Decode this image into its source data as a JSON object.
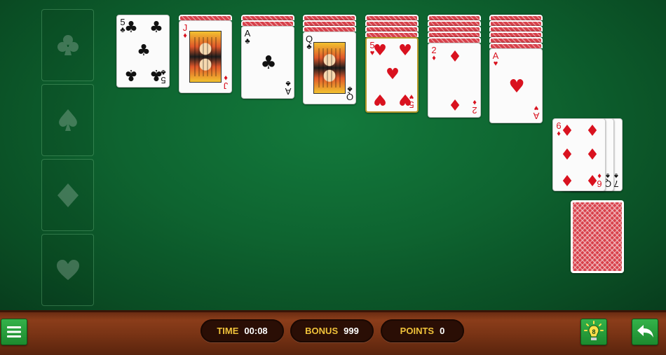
{
  "foundations": [
    {
      "suit": "clubs",
      "icon": "club-icon"
    },
    {
      "suit": "spades",
      "icon": "spade-icon"
    },
    {
      "suit": "diamonds",
      "icon": "diamond-icon"
    },
    {
      "suit": "hearts",
      "icon": "heart-icon"
    }
  ],
  "tableau": [
    {
      "hidden": 0,
      "top": {
        "rank": "5",
        "suit": "♣",
        "color": "black"
      }
    },
    {
      "hidden": 1,
      "top": {
        "rank": "J",
        "suit": "♦",
        "color": "red"
      }
    },
    {
      "hidden": 2,
      "top": {
        "rank": "A",
        "suit": "♣",
        "color": "black"
      }
    },
    {
      "hidden": 3,
      "top": {
        "rank": "Q",
        "suit": "♣",
        "color": "black"
      }
    },
    {
      "hidden": 4,
      "top": {
        "rank": "5",
        "suit": "♥",
        "color": "red"
      }
    },
    {
      "hidden": 5,
      "top": {
        "rank": "2",
        "suit": "♦",
        "color": "red"
      }
    },
    {
      "hidden": 6,
      "top": {
        "rank": "A",
        "suit": "♥",
        "color": "red"
      }
    }
  ],
  "waste": [
    {
      "rank": "7",
      "suit": "♠",
      "color": "black"
    },
    {
      "rank": "Q",
      "suit": "♠",
      "color": "black"
    },
    {
      "rank": "6",
      "suit": "♦",
      "color": "red"
    }
  ],
  "stock": {
    "face": "down"
  },
  "status": {
    "time_label": "TIME",
    "time_value": "00:08",
    "bonus_label": "BONUS",
    "bonus_value": "999",
    "points_label": "POINTS",
    "points_value": "0"
  },
  "buttons": {
    "menu_icon": "hamburger-menu-icon",
    "hint_icon": "lightbulb-hint-icon",
    "hint_count": "8",
    "undo_icon": "undo-arrow-icon"
  },
  "colors": {
    "felt": "#0e6430",
    "card_back": "#d8404a",
    "button_green": "#2a9e3c",
    "label_gold": "#f0c23a",
    "red_suit": "#d9121f"
  }
}
